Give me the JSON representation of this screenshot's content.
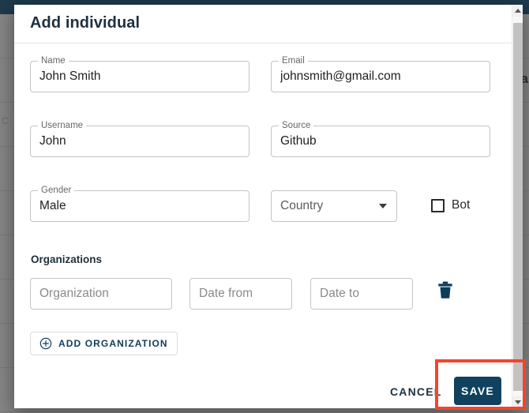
{
  "background": {
    "left_partial_text": "C",
    "right_partial_text": "a"
  },
  "dialog": {
    "title": "Add individual",
    "fields": {
      "name": {
        "label": "Name",
        "value": "John Smith"
      },
      "email": {
        "label": "Email",
        "value": "johnsmith@gmail.com"
      },
      "username": {
        "label": "Username",
        "value": "John"
      },
      "source": {
        "label": "Source",
        "value": "Github"
      },
      "gender": {
        "label": "Gender",
        "value": "Male"
      }
    },
    "country_select": {
      "placeholder": "Country",
      "selected": "Country",
      "icon": "chevron-down-icon"
    },
    "bot_checkbox": {
      "label": "Bot",
      "checked": false
    },
    "organizations": {
      "section_title": "Organizations",
      "rows": [
        {
          "organization_placeholder": "Organization",
          "organization_value": "",
          "date_from_placeholder": "Date from",
          "date_from_value": "",
          "date_to_placeholder": "Date to",
          "date_to_value": "",
          "delete_icon": "trash-icon"
        }
      ],
      "add_button": {
        "label": "ADD ORGANIZATION",
        "icon": "plus-circle-icon"
      }
    },
    "footer": {
      "cancel_label": "CANCEL",
      "save_label": "SAVE"
    },
    "scrollbar": {
      "up_icon": "chevron-up-icon",
      "down_icon": "chevron-down-icon"
    }
  },
  "colors": {
    "topbar": "#1e3a4c",
    "overlay": "#808080",
    "primary": "#10425f",
    "highlight": "#f4442e",
    "field_border": "#c4c4c4",
    "label_text": "#676767"
  }
}
